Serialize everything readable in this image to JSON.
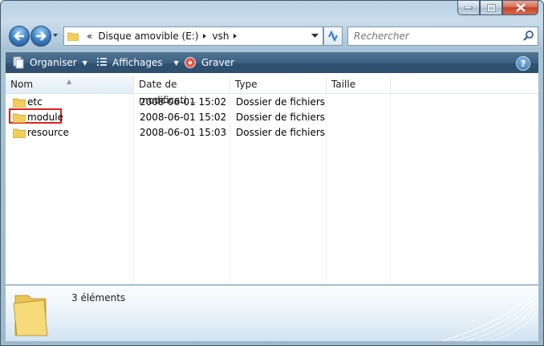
{
  "window": {
    "caption_buttons": [
      "minimize",
      "maximize",
      "close"
    ]
  },
  "address_bar": {
    "overflow": "«",
    "crumbs": [
      "Disque amovible (E:)",
      "vsh"
    ]
  },
  "search": {
    "placeholder": "Rechercher"
  },
  "command_bar": {
    "organize": "Organiser",
    "views": "Affichages",
    "burn": "Graver",
    "help": "?"
  },
  "columns": {
    "name": "Nom",
    "date": "Date de modificati...",
    "type": "Type",
    "size": "Taille"
  },
  "files": [
    {
      "name": "etc",
      "date": "2008-06-01 15:02",
      "type": "Dossier de fichiers",
      "size": ""
    },
    {
      "name": "module",
      "date": "2008-06-01 15:02",
      "type": "Dossier de fichiers",
      "size": ""
    },
    {
      "name": "resource",
      "date": "2008-06-01 15:03",
      "type": "Dossier de fichiers",
      "size": ""
    }
  ],
  "details": {
    "count": "3 éléments"
  },
  "colors": {
    "highlight_box": "#e0201c",
    "command_bar": "#3c5f7f",
    "folder": "#f2cf5c"
  }
}
